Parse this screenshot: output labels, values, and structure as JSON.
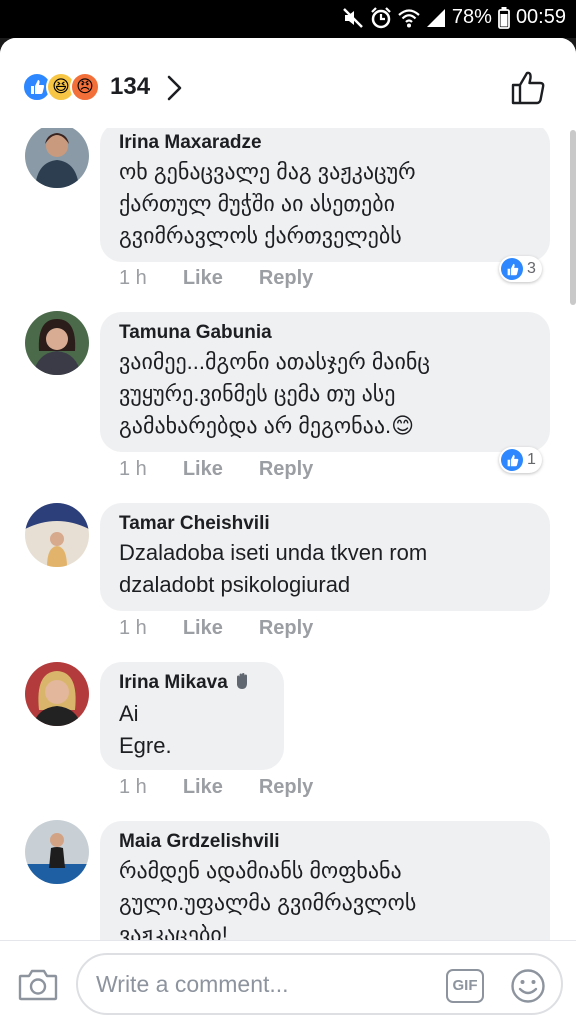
{
  "status_bar": {
    "battery_percent": "78%",
    "time": "00:59"
  },
  "header": {
    "reaction_count": "134",
    "reaction_icons": [
      "like-icon",
      "haha-icon",
      "angry-icon"
    ]
  },
  "comments": [
    {
      "author": "Irina Maxaradze",
      "text": "ოხ გენაცვალე მაგ ვაჟკაცურ\nქართულ მუჭში აი ასეთები\nგვიმრავლოს ქართველებს",
      "time": "1 h",
      "like": "Like",
      "reply": "Reply",
      "reactions": "3"
    },
    {
      "author": "Tamuna Gabunia",
      "text": "ვაიმეე...მგონი ათასჯერ მაინც\nვუყურე.ვინმეს ცემა თუ ასე\nგამახარებდა არ მეგონაა.😊",
      "time": "1 h",
      "like": "Like",
      "reply": "Reply",
      "reactions": "1"
    },
    {
      "author": "Tamar Cheishvili",
      "text": "Dzaladoba iseti unda tkven rom\ndzaladobt psikologiurad",
      "time": "1 h",
      "like": "Like",
      "reply": "Reply"
    },
    {
      "author": "Irina Mikava",
      "text": "Ai\nEgre.",
      "time": "1 h",
      "like": "Like",
      "reply": "Reply"
    },
    {
      "author": "Maia Grdzelishvili",
      "text": "რამდენ ადამიანს მოფხანა\nგული.უფალმა გვიმრავლოს\nვაჟკაცები!"
    }
  ],
  "composer": {
    "placeholder": "Write a comment...",
    "gif_label": "GIF"
  }
}
